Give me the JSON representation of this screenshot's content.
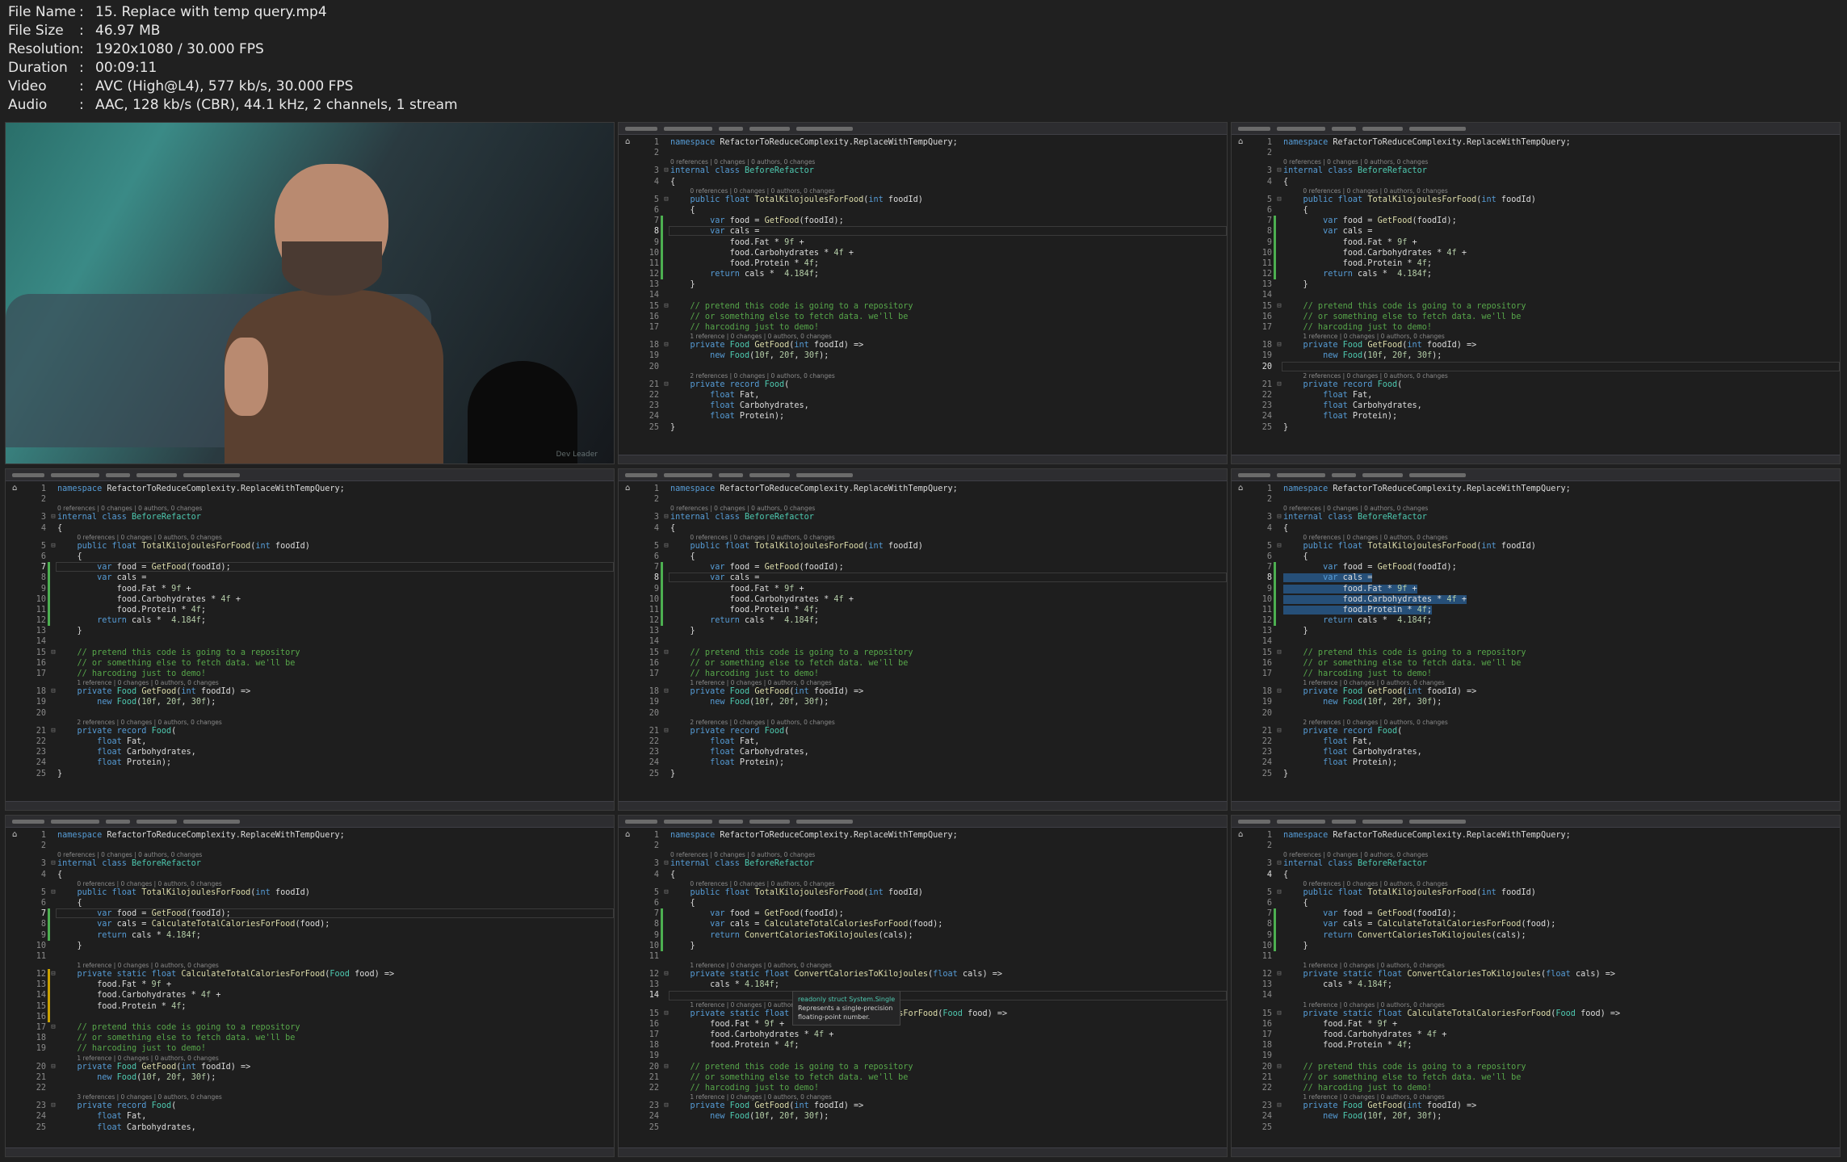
{
  "file_info": [
    {
      "key": "File Name",
      "value": "15. Replace with temp query.mp4"
    },
    {
      "key": "File Size",
      "value": "46.97 MB"
    },
    {
      "key": "Resolution",
      "value": "1920x1080 / 30.000 FPS"
    },
    {
      "key": "Duration",
      "value": "00:09:11"
    },
    {
      "key": "Video",
      "value": "AVC (High@L4), 577 kb/s, 30.000 FPS"
    },
    {
      "key": "Audio",
      "value": "AAC, 128 kb/s (CBR), 44.1 kHz, 2 channels, 1 stream"
    }
  ],
  "separator": ":",
  "webcam": {
    "watermark": "Dev Leader"
  },
  "lens": {
    "zero": "0 references | 0 changes | 0 authors, 0 changes",
    "one": "1 reference | 0 changes | 0 authors, 0 changes",
    "two": "2 references | 0 changes | 0 authors, 0 changes",
    "three": "3 references | 0 changes | 0 authors, 0 changes"
  },
  "code_before": [
    {
      "n": "1",
      "text": "namespace RefactorToReduceComplexity.ReplaceWithTempQuery;"
    },
    {
      "n": "2",
      "text": ""
    },
    {
      "n": "3",
      "text": "internal class BeforeRefactor",
      "lens": "zero",
      "fold": true
    },
    {
      "n": "4",
      "text": "{"
    },
    {
      "n": "5",
      "text": "    public float TotalKilojoulesForFood(int foodId)",
      "lens": "zero",
      "fold": true
    },
    {
      "n": "6",
      "text": "    {"
    },
    {
      "n": "7",
      "text": "        var food = GetFood(foodId);"
    },
    {
      "n": "8",
      "text": "        var cals ="
    },
    {
      "n": "9",
      "text": "            food.Fat * 9f +"
    },
    {
      "n": "10",
      "text": "            food.Carbohydrates * 4f +"
    },
    {
      "n": "11",
      "text": "            food.Protein * 4f;"
    },
    {
      "n": "12",
      "text": "        return cals *  4.184f;"
    },
    {
      "n": "13",
      "text": "    }"
    },
    {
      "n": "14",
      "text": ""
    },
    {
      "n": "15",
      "text": "    // pretend this code is going to a repository",
      "fold": true
    },
    {
      "n": "16",
      "text": "    // or something else to fetch data. we'll be"
    },
    {
      "n": "17",
      "text": "    // harcoding just to demo!"
    },
    {
      "n": "18",
      "text": "    private Food GetFood(int foodId) =>",
      "lens": "one",
      "fold": true
    },
    {
      "n": "19",
      "text": "        new Food(10f, 20f, 30f);"
    },
    {
      "n": "20",
      "text": ""
    },
    {
      "n": "21",
      "text": "    private record Food(",
      "lens": "two",
      "fold": true
    },
    {
      "n": "22",
      "text": "        float Fat,"
    },
    {
      "n": "23",
      "text": "        float Carbohydrates,"
    },
    {
      "n": "24",
      "text": "        float Protein);"
    },
    {
      "n": "25",
      "text": "}"
    }
  ],
  "code_step1": [
    {
      "n": "1",
      "text": "namespace RefactorToReduceComplexity.ReplaceWithTempQuery;"
    },
    {
      "n": "2",
      "text": ""
    },
    {
      "n": "3",
      "text": "internal class BeforeRefactor",
      "lens": "zero",
      "fold": true
    },
    {
      "n": "4",
      "text": "{"
    },
    {
      "n": "5",
      "text": "    public float TotalKilojoulesForFood(int foodId)",
      "lens": "zero",
      "fold": true
    },
    {
      "n": "6",
      "text": "    {"
    },
    {
      "n": "7",
      "text": "        var food = GetFood(foodId);"
    },
    {
      "n": "8",
      "text": "        var cals = CalculateTotalCaloriesForFood(food);"
    },
    {
      "n": "9",
      "text": "        return cals * 4.184f;"
    },
    {
      "n": "10",
      "text": "    }"
    },
    {
      "n": "11",
      "text": ""
    },
    {
      "n": "12",
      "text": "    private static float CalculateTotalCaloriesForFood(Food food) =>",
      "lens": "one",
      "fold": true
    },
    {
      "n": "13",
      "text": "        food.Fat * 9f +"
    },
    {
      "n": "14",
      "text": "        food.Carbohydrates * 4f +"
    },
    {
      "n": "15",
      "text": "        food.Protein * 4f;"
    },
    {
      "n": "16",
      "text": ""
    },
    {
      "n": "17",
      "text": "    // pretend this code is going to a repository",
      "fold": true
    },
    {
      "n": "18",
      "text": "    // or something else to fetch data. we'll be"
    },
    {
      "n": "19",
      "text": "    // harcoding just to demo!"
    },
    {
      "n": "20",
      "text": "    private Food GetFood(int foodId) =>",
      "lens": "one",
      "fold": true
    },
    {
      "n": "21",
      "text": "        new Food(10f, 20f, 30f);"
    },
    {
      "n": "22",
      "text": ""
    },
    {
      "n": "23",
      "text": "    private record Food(",
      "lens": "three",
      "fold": true
    },
    {
      "n": "24",
      "text": "        float Fat,"
    },
    {
      "n": "25",
      "text": "        float Carbohydrates,"
    }
  ],
  "code_step2": [
    {
      "n": "1",
      "text": "namespace RefactorToReduceComplexity.ReplaceWithTempQuery;"
    },
    {
      "n": "2",
      "text": ""
    },
    {
      "n": "3",
      "text": "internal class BeforeRefactor",
      "lens": "zero",
      "fold": true
    },
    {
      "n": "4",
      "text": "{"
    },
    {
      "n": "5",
      "text": "    public float TotalKilojoulesForFood(int foodId)",
      "lens": "zero",
      "fold": true
    },
    {
      "n": "6",
      "text": "    {"
    },
    {
      "n": "7",
      "text": "        var food = GetFood(foodId);"
    },
    {
      "n": "8",
      "text": "        var cals = CalculateTotalCaloriesForFood(food);"
    },
    {
      "n": "9",
      "text": "        return ConvertCaloriesToKilojoules(cals);"
    },
    {
      "n": "10",
      "text": "    }"
    },
    {
      "n": "11",
      "text": ""
    },
    {
      "n": "12",
      "text": "    private static float ConvertCaloriesToKilojoules(float cals) =>",
      "lens": "one",
      "fold": true
    },
    {
      "n": "13",
      "text": "        cals * 4.184f;"
    },
    {
      "n": "14",
      "text": ""
    },
    {
      "n": "15",
      "text": "    private static float CalculateTotalCaloriesForFood(Food food) =>",
      "lens": "one",
      "fold": true
    },
    {
      "n": "16",
      "text": "        food.Fat * 9f +"
    },
    {
      "n": "17",
      "text": "        food.Carbohydrates * 4f +"
    },
    {
      "n": "18",
      "text": "        food.Protein * 4f;"
    },
    {
      "n": "19",
      "text": ""
    },
    {
      "n": "20",
      "text": "    // pretend this code is going to a repository",
      "fold": true
    },
    {
      "n": "21",
      "text": "    // or something else to fetch data. we'll be"
    },
    {
      "n": "22",
      "text": "    // harcoding just to demo!"
    },
    {
      "n": "23",
      "text": "    private Food GetFood(int foodId) =>",
      "lens": "one",
      "fold": true
    },
    {
      "n": "24",
      "text": "        new Food(10f, 20f, 30f);"
    },
    {
      "n": "25",
      "text": ""
    }
  ],
  "tooltip": {
    "line1": "readonly struct System.Single",
    "line2": "Represents a single-precision",
    "line3": "floating-point number."
  },
  "colors": {
    "keyword": "#569cd6",
    "type": "#4ec9b0",
    "comment": "#57a64a",
    "background": "#1e1e1e"
  }
}
